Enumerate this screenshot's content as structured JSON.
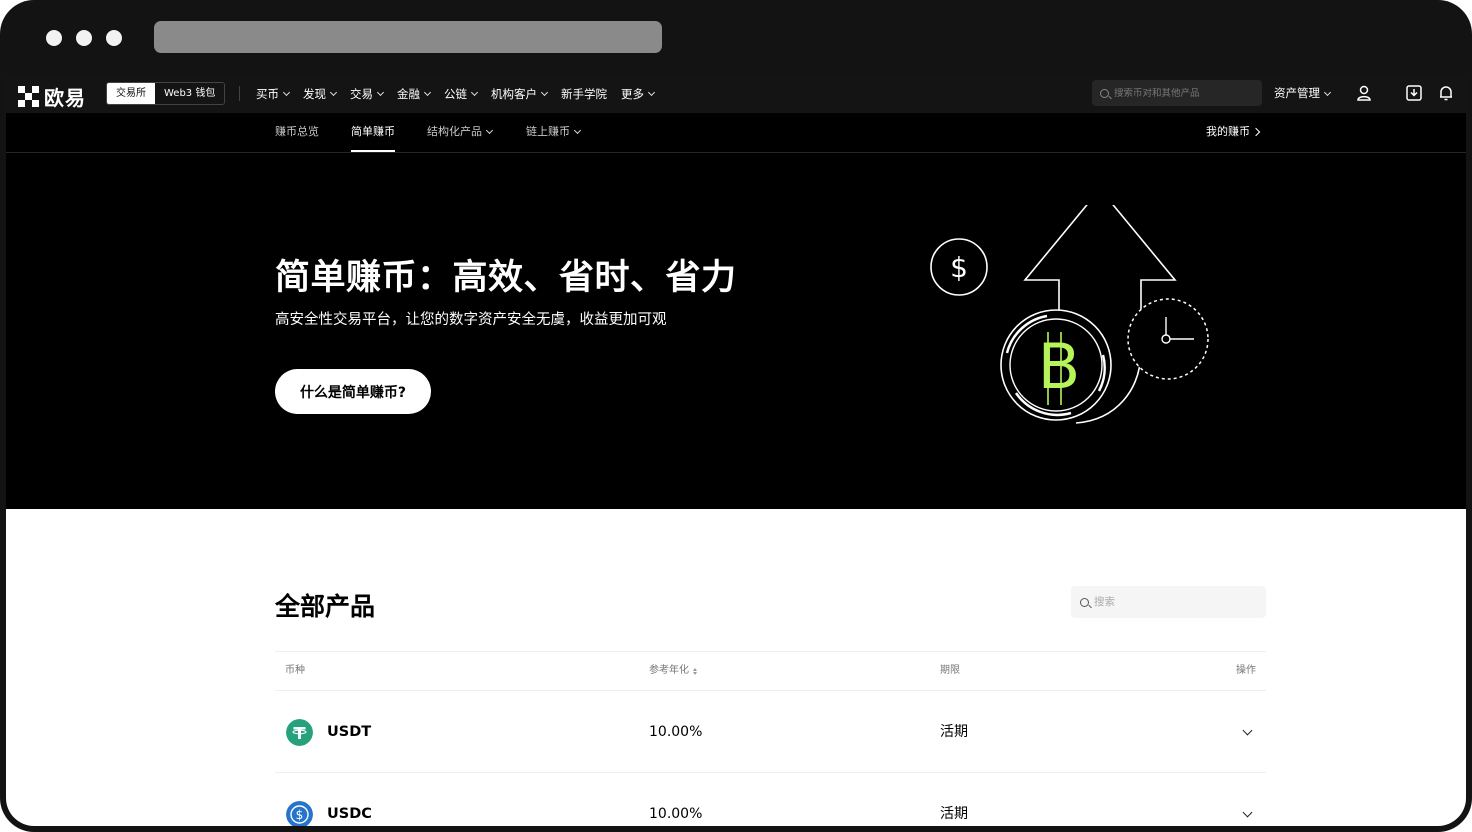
{
  "brand": {
    "logo_text": "欧易"
  },
  "mode_switch": {
    "exchange": "交易所",
    "wallet": "Web3 钱包"
  },
  "menu": [
    "买币",
    "发现",
    "交易",
    "金融",
    "公链",
    "机构客户",
    "新手学院",
    "更多"
  ],
  "menu_has_chevron": [
    true,
    true,
    true,
    true,
    true,
    true,
    false,
    true
  ],
  "top_search": {
    "placeholder": "搜索币对和其他产品"
  },
  "assets_label": "资产管理",
  "subnav": {
    "items": [
      "赚币总览",
      "简单赚币",
      "结构化产品",
      "链上赚币"
    ],
    "active": "简单赚币",
    "right_link": "我的赚币"
  },
  "hero": {
    "title": "简单赚币：高效、省时、省力",
    "subtitle": "高安全性交易平台，让您的数字资产安全无虞，收益更加可观",
    "button": "什么是简单赚币?"
  },
  "products": {
    "title": "全部产品",
    "search_placeholder": "搜索",
    "columns": [
      "币种",
      "参考年化",
      "期限",
      "操作"
    ],
    "rows": [
      {
        "coin": "USDT",
        "apy": "10.00%",
        "term": "活期",
        "icon_color": "#26a17b"
      },
      {
        "coin": "USDC",
        "apy": "10.00%",
        "term": "活期",
        "icon_color": "#2775ca"
      }
    ]
  },
  "colors": {
    "accent_green": "#b6f45a",
    "hero_bg": "#000000",
    "nav_bg": "#141414"
  },
  "icons": [
    "search-icon",
    "user-icon",
    "download-icon",
    "bell-icon",
    "dollar-icon",
    "bitcoin-icon",
    "clock-icon",
    "arrow-up-icon"
  ]
}
